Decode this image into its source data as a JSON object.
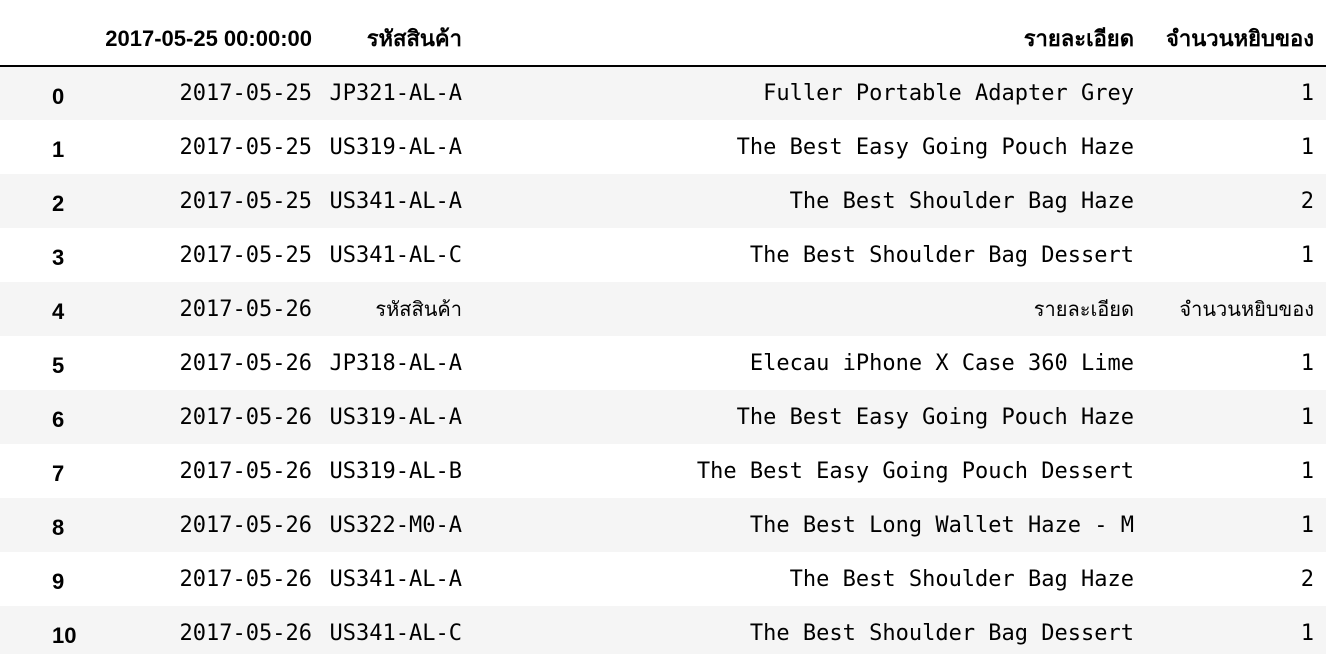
{
  "table": {
    "headers": {
      "index": "",
      "date": "2017-05-25 00:00:00",
      "sku": "รหัสสินค้า",
      "description": "รายละเอียด",
      "quantity": "จำนวนหยิบของ"
    },
    "rows": [
      {
        "index": "0",
        "date": "2017-05-25",
        "sku": "JP321-AL-A",
        "description": "Fuller Portable Adapter Grey",
        "quantity": "1"
      },
      {
        "index": "1",
        "date": "2017-05-25",
        "sku": "US319-AL-A",
        "description": "The Best Easy Going Pouch Haze",
        "quantity": "1"
      },
      {
        "index": "2",
        "date": "2017-05-25",
        "sku": "US341-AL-A",
        "description": "The Best Shoulder Bag Haze",
        "quantity": "2"
      },
      {
        "index": "3",
        "date": "2017-05-25",
        "sku": "US341-AL-C",
        "description": "The Best Shoulder Bag Dessert",
        "quantity": "1"
      },
      {
        "index": "4",
        "date": "2017-05-26",
        "sku": "รหัสสินค้า",
        "description": "รายละเอียด",
        "quantity": "จำนวนหยิบของ"
      },
      {
        "index": "5",
        "date": "2017-05-26",
        "sku": "JP318-AL-A",
        "description": "Elecau iPhone X Case 360 Lime",
        "quantity": "1"
      },
      {
        "index": "6",
        "date": "2017-05-26",
        "sku": "US319-AL-A",
        "description": "The Best Easy Going Pouch Haze",
        "quantity": "1"
      },
      {
        "index": "7",
        "date": "2017-05-26",
        "sku": "US319-AL-B",
        "description": "The Best Easy Going Pouch Dessert",
        "quantity": "1"
      },
      {
        "index": "8",
        "date": "2017-05-26",
        "sku": "US322-M0-A",
        "description": "The Best Long Wallet Haze - M",
        "quantity": "1"
      },
      {
        "index": "9",
        "date": "2017-05-26",
        "sku": "US341-AL-A",
        "description": "The Best Shoulder Bag Haze",
        "quantity": "2"
      },
      {
        "index": "10",
        "date": "2017-05-26",
        "sku": "US341-AL-C",
        "description": "The Best Shoulder Bag Dessert",
        "quantity": "1"
      }
    ],
    "colors": {
      "stripe": "#f5f5f5",
      "background": "#ffffff",
      "text": "#000000",
      "header_rule": "#000000"
    }
  }
}
